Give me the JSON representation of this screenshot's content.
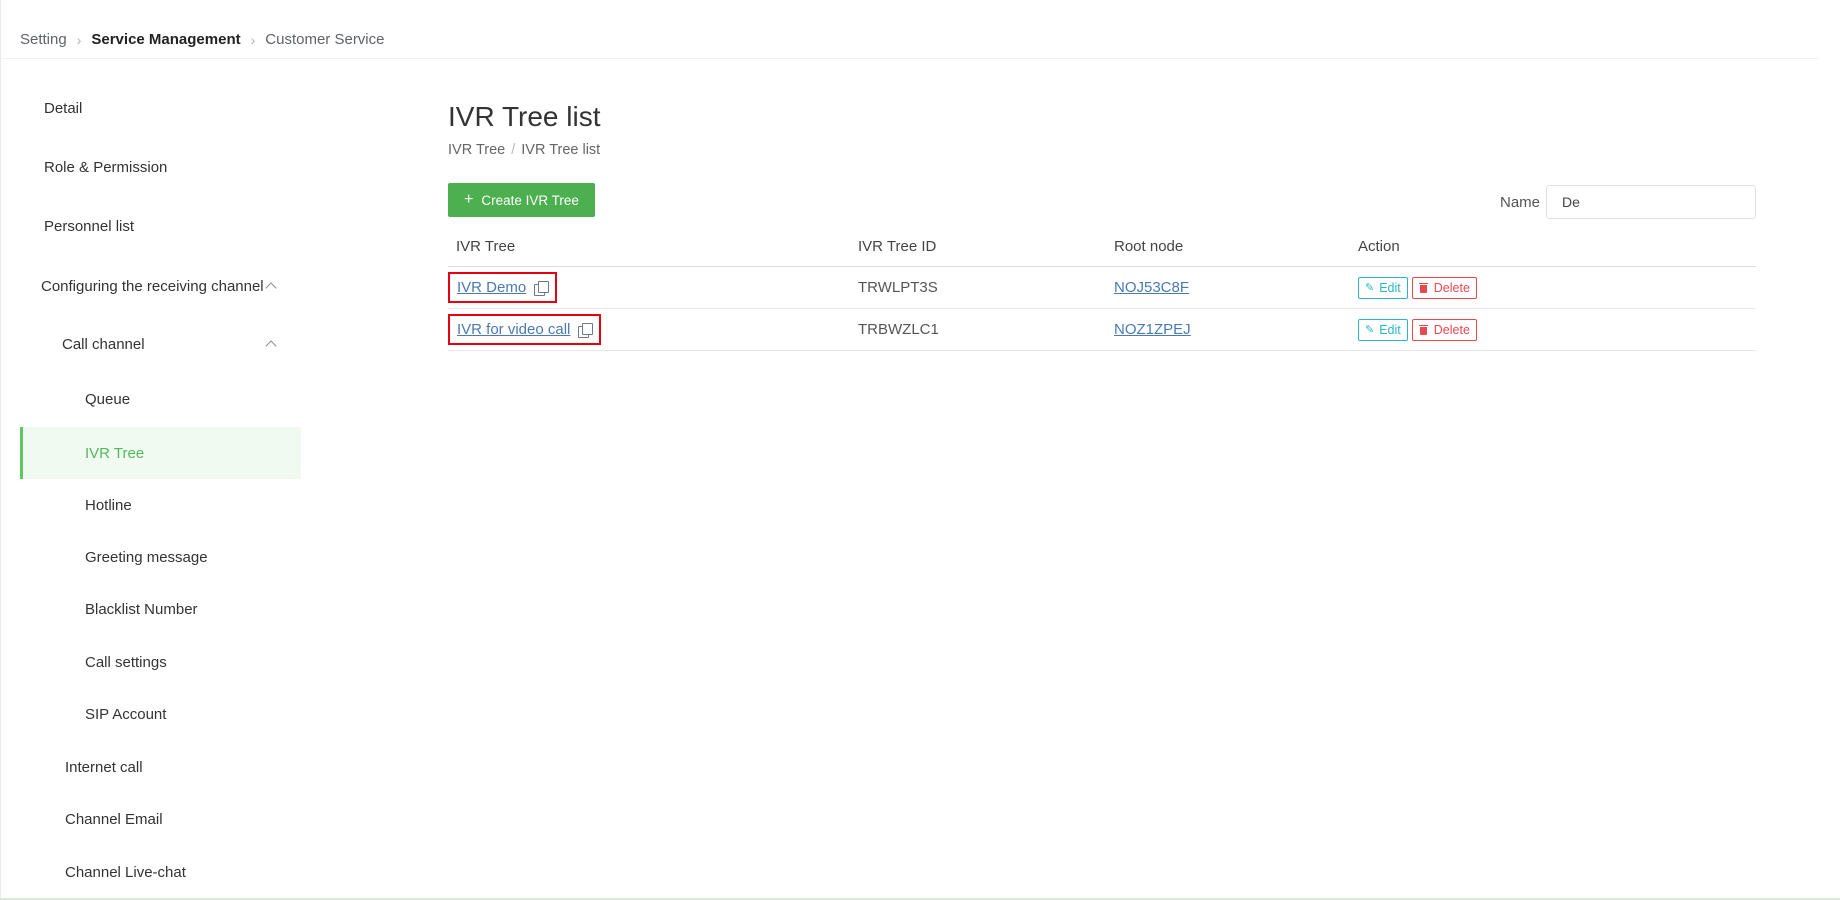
{
  "breadcrumb": [
    "Setting",
    "Service Management",
    "Customer Service"
  ],
  "sidebar": {
    "items": [
      {
        "label": "Detail"
      },
      {
        "label": "Role & Permission"
      },
      {
        "label": "Personnel list"
      },
      {
        "label": "Configuring the receiving channel"
      },
      {
        "label": "Call channel"
      },
      {
        "label": "Queue"
      },
      {
        "label": "IVR Tree"
      },
      {
        "label": "Hotline"
      },
      {
        "label": "Greeting message"
      },
      {
        "label": "Blacklist Number"
      },
      {
        "label": "Call settings"
      },
      {
        "label": "SIP Account"
      },
      {
        "label": "Internet call"
      },
      {
        "label": "Channel Email"
      },
      {
        "label": "Channel Live-chat"
      }
    ],
    "active": "IVR Tree"
  },
  "main": {
    "title": "IVR Tree list",
    "sub_breadcrumb": [
      "IVR Tree",
      "IVR Tree list"
    ],
    "create_button": "Create IVR Tree",
    "filter": {
      "label": "Name",
      "value": "De"
    },
    "table": {
      "columns": [
        "IVR Tree",
        "IVR Tree ID",
        "Root node",
        "Action"
      ],
      "rows": [
        {
          "name": "IVR Demo",
          "id": "TRWLPT3S",
          "root_node": "NOJ53C8F"
        },
        {
          "name": "IVR for video call",
          "id": "TRBWZLC1",
          "root_node": "NOZ1ZPEJ"
        }
      ],
      "edit_label": "Edit",
      "delete_label": "Delete"
    }
  },
  "colors": {
    "accent_green": "#4caf50",
    "active_text": "#52b95a",
    "link": "#4a7ab0",
    "edit": "#29b6c6",
    "delete": "#e8484f",
    "highlight_box": "#e60012"
  },
  "icons": [
    "chevron-right-icon",
    "chevron-up-icon",
    "plus-icon",
    "copy-icon",
    "pencil-icon",
    "trash-icon"
  ]
}
